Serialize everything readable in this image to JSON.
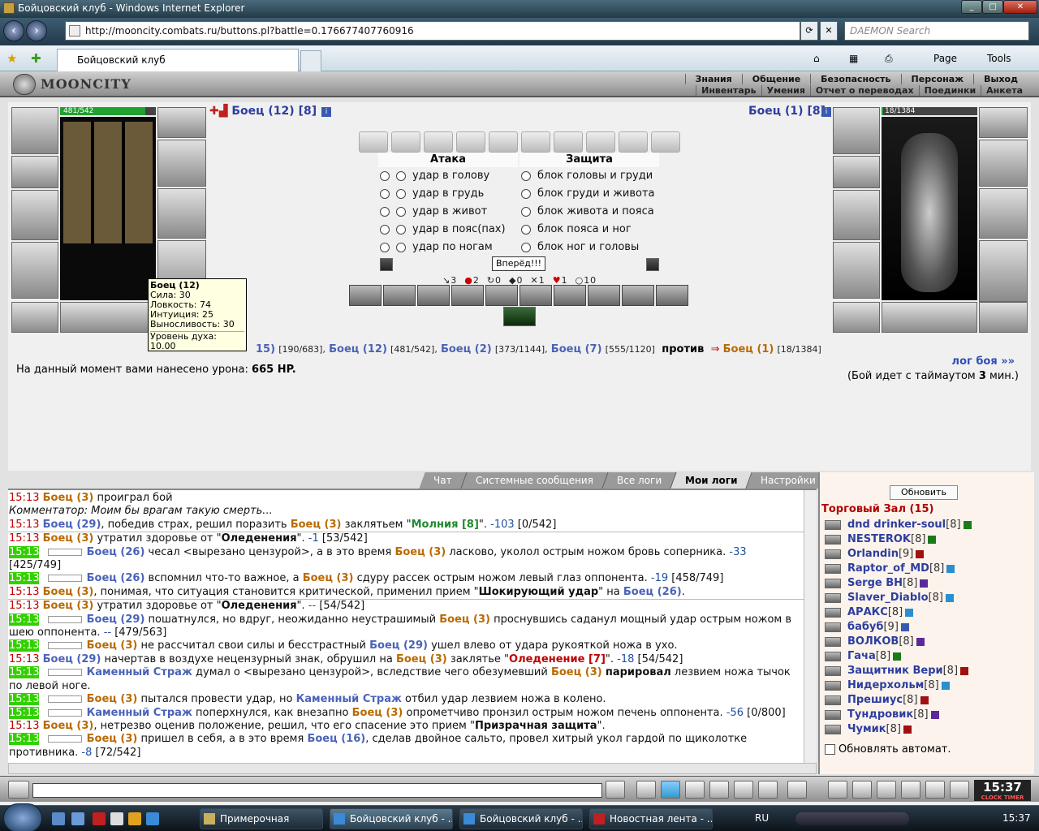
{
  "window": {
    "title": "Бойцовский клуб - Windows Internet Explorer"
  },
  "browser": {
    "url": "http://mooncity.combats.ru/buttons.pl?battle=0.176677407760916",
    "search_placeholder": "DAEMON Search",
    "tab_title": "Бойцовский клуб",
    "page_label": "Page",
    "tools_label": "Tools"
  },
  "game": {
    "logo": "MOONCITY",
    "menu_top": [
      "Знания",
      "Общение",
      "Безопасность",
      "Персонаж",
      "Выход"
    ],
    "menu_bottom": [
      "Инвентарь",
      "Умения",
      "Отчет о переводах",
      "Поединки",
      "Анкета"
    ]
  },
  "battle": {
    "left_name": "Боец (12)",
    "left_level": "[8]",
    "left_hp": "481/542",
    "left_hp_frac": 0.887,
    "right_name": "Боец (1)",
    "right_level": "[8]",
    "right_hp": "18/1384",
    "right_hp_frac": 0.013,
    "attack_header": "Атака",
    "defense_header": "Защита",
    "attacks": [
      "удар в голову",
      "удар в грудь",
      "удар в живот",
      "удар в пояс(пах)",
      "удар по ногам"
    ],
    "blocks": [
      "блок головы и груди",
      "блок груди и живота",
      "блок живота и пояса",
      "блок пояса и ног",
      "блок ног и головы"
    ],
    "forward_button": "Вперёд!!!",
    "stats": [
      "3",
      "2",
      "0",
      "0",
      "1",
      "1",
      "10"
    ],
    "tooltip": {
      "name": "Боец (12)",
      "lines": [
        "Сила: 30",
        "Ловкость: 74",
        "Интуиция: 25",
        "Выносливость: 30"
      ],
      "spirit": "Уровень духа: 10.00"
    },
    "fight_line": {
      "p1": "15)",
      "p1hp": "[190/683],",
      "p2": "Боец (12)",
      "p2hp": "[481/542],",
      "p3": "Боец (2)",
      "p3hp": "[373/1144],",
      "p4": "Боец (7)",
      "p4hp": "[555/1120]",
      "vs": "против",
      "enemy": "Боец (1)",
      "enemyhp": "[18/1384]"
    },
    "damage_text": "На данный момент вами нанесено урона:",
    "damage_value": "665 HP.",
    "log_link": "лог боя »»",
    "timeout_pre": "(Бой идет с таймаутом",
    "timeout_val": "3",
    "timeout_post": "мин.)"
  },
  "log_tabs": [
    "Чат",
    "Системные сообщения",
    "Все логи",
    "Мои логи",
    "Настройки"
  ],
  "log": [
    {
      "t": "15:13",
      "hl": false,
      "html": "<span class='orange'>Боец (3)</span> проиграл бой",
      "sep": false
    },
    {
      "t": "",
      "hl": false,
      "html": "Комментатор: Моим бы врагам такую смерть...",
      "it": true,
      "sep": false
    },
    {
      "t": "15:13",
      "hl": false,
      "html": "<span class='blue'>Боец (29)</span>, победив страх, решил поразить <span class='orange'>Боец (3)</span> заклятьем \"<span class='green'><b>Молния [8]</b></span>\". <span class='num'>-103</span> [0/542]",
      "sep": true
    },
    {
      "t": "15:13",
      "hl": false,
      "html": "<span class='orange'>Боец (3)</span> утратил здоровье от \"<b>Оледенения</b>\". <span class='num'>-1</span> [53/542]",
      "sep": false
    },
    {
      "t": "15:13",
      "hl": true,
      "box": true,
      "html": "<span class='blue'>Боец (26)</span> чесал &lt;вырезано цензурой&gt;, а в это время <span class='orange'>Боец (3)</span> ласково, уколол острым ножом бровь соперника. <span class='num'>-33</span> [425/749]",
      "sep": false
    },
    {
      "t": "15:13",
      "hl": true,
      "box": true,
      "html": "<span class='blue'>Боец (26)</span> вспомнил что-то важное, а <span class='orange'>Боец (3)</span> сдуру рассек острым ножом левый глаз оппонента. <span class='num'>-19</span> [458/749]",
      "sep": false
    },
    {
      "t": "15:13",
      "hl": false,
      "html": "<span class='orange'>Боец (3)</span>, понимая, что ситуация становится критической, применил прием \"<b>Шокирующий удар</b>\" на <span class='blue'>Боец (26)</span>.",
      "sep": true
    },
    {
      "t": "15:13",
      "hl": false,
      "html": "<span class='orange'>Боец (3)</span> утратил здоровье от \"<b>Оледенения</b>\". <span class='num'>--</span> [54/542]",
      "sep": false
    },
    {
      "t": "15:13",
      "hl": true,
      "box": true,
      "html": "<span class='blue'>Боец (29)</span> пошатнулся, но вдруг, неожиданно неустрашимый <span class='orange'>Боец (3)</span> проснувшись саданул мощный удар острым ножом в шею оппонента. <span class='num'>--</span> [479/563]",
      "sep": false
    },
    {
      "t": "15:13",
      "hl": true,
      "box": true,
      "html": "<span class='orange'>Боец (3)</span> не рассчитал свои силы и бесстрастный <span class='blue'>Боец (29)</span> ушел влево от удара рукояткой ножа в ухо.",
      "sep": false
    },
    {
      "t": "15:13",
      "hl": false,
      "html": "<span class='blue'>Боец (29)</span> начертав в воздухе нецензурный знак, обрушил на <span class='orange'>Боец (3)</span> заклятье \"<b style='color:#c00000'>Оледенение [7]</b>\". <span class='num'>-18</span> [54/542]",
      "sep": false
    },
    {
      "t": "15:13",
      "hl": true,
      "box": true,
      "html": "<span class='blue'>Каменный Страж</span> думал о &lt;вырезано цензурой&gt;, вследствие чего обезумевший <span class='orange'>Боец (3)</span> <b>парировал</b> лезвием ножа тычок по левой ноге.",
      "sep": false
    },
    {
      "t": "15:13",
      "hl": true,
      "box": true,
      "html": "<span class='orange'>Боец (3)</span> пытался провести удар, но <span class='blue'>Каменный Страж</span> отбил удар лезвием ножа в колено.",
      "sep": false
    },
    {
      "t": "15:13",
      "hl": true,
      "box": true,
      "html": "<span class='blue'>Каменный Страж</span> поперхнулся, как внезапно <span class='orange'>Боец (3)</span> опрометчиво пронзил острым ножом печень оппонента. <span class='num'>-56</span> [0/800]",
      "sep": false
    },
    {
      "t": "15:13",
      "hl": false,
      "html": "<span class='orange'>Боец (3)</span>, нетрезво оценив положение, решил, что его спасение это прием \"<b>Призрачная защита</b>\".",
      "sep": false
    },
    {
      "t": "15:13",
      "hl": true,
      "box": true,
      "html": "<span class='orange'>Боец (3)</span> пришел в себя, а в это время <span class='blue'>Боец (16)</span>, сделав двойное сальто, провел хитрый укол гардой по щиколотке противника. <span class='num'>-8</span> [72/542]",
      "sep": false
    }
  ],
  "room": {
    "refresh": "Обновить",
    "title": "Торговый Зал (15)",
    "auto": "Обновлять автомат.",
    "users": [
      {
        "n": "dnd drinker-soul",
        "l": "[8]",
        "c": "#1a7a1a"
      },
      {
        "n": "NESTEROK",
        "l": "[8]",
        "c": "#1a7a1a"
      },
      {
        "n": "Orlandin",
        "l": "[9]",
        "c": "#a01010"
      },
      {
        "n": "Raptor_of_MD",
        "l": "[8]",
        "c": "#2a8fd0"
      },
      {
        "n": "Serge BH",
        "l": "[8]",
        "c": "#5a2a9a"
      },
      {
        "n": "Slaver_Diablo",
        "l": "[8]",
        "c": "#2a8fd0"
      },
      {
        "n": "АРАКС",
        "l": "[8]",
        "c": "#2a8fd0"
      },
      {
        "n": "бабуб",
        "l": "[9]",
        "c": "#3a5ab0"
      },
      {
        "n": "ВОЛКОВ",
        "l": "[8]",
        "c": "#5a2a9a"
      },
      {
        "n": "Гача",
        "l": "[8]",
        "c": "#1a7a1a"
      },
      {
        "n": "Защитник Вери",
        "l": "[8]",
        "c": "#a01010"
      },
      {
        "n": "Нидерхольм",
        "l": "[8]",
        "c": "#2a8fd0"
      },
      {
        "n": "Прешиус",
        "l": "[8]",
        "c": "#a01010"
      },
      {
        "n": "Тундровик",
        "l": "[8]",
        "c": "#5a2a9a"
      },
      {
        "n": "Чумик",
        "l": "[8]",
        "c": "#a01010"
      }
    ]
  },
  "clock": {
    "time": "15:37",
    "label": "CLOCK TIMER"
  },
  "taskbar": {
    "items": [
      "Примерочная",
      "Бойцовский клуб - ...",
      "Бойцовский клуб - ...",
      "Новостная лента - ..."
    ],
    "lang": "RU",
    "time": "15:37"
  }
}
